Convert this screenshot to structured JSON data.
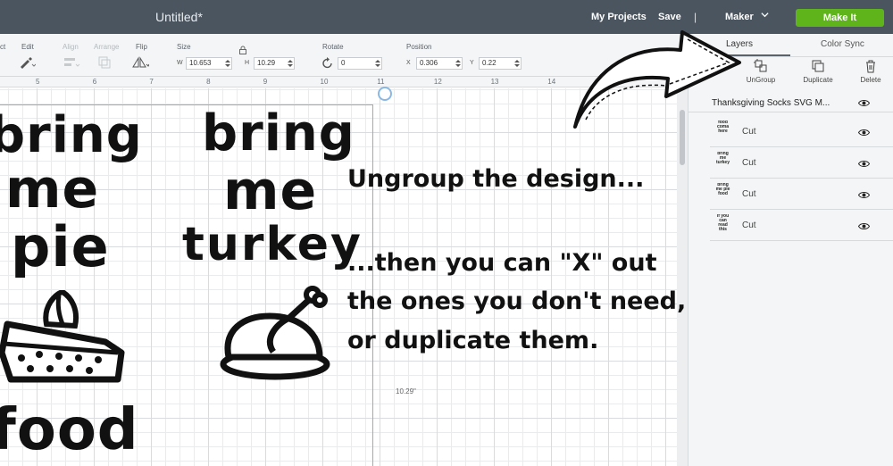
{
  "topbar": {
    "title": "Untitled*",
    "my_projects": "My Projects",
    "save": "Save",
    "separator": "|",
    "machine": "Maker",
    "make_it": "Make It",
    "make_it_color": "#5fb41c"
  },
  "toolbar": {
    "select_label": "ct",
    "edit_label": "Edit",
    "align_label": "Align",
    "arrange_label": "Arrange",
    "flip_label": "Flip",
    "size_label": "Size",
    "width_tag": "W",
    "width_value": "10.653",
    "height_tag": "H",
    "height_value": "10.29",
    "rotate_label": "Rotate",
    "rotate_value": "0",
    "position_label": "Position",
    "x_tag": "X",
    "x_value": "0.306",
    "y_tag": "Y",
    "y_value": "0.22"
  },
  "ruler": {
    "ticks": [
      "5",
      "6",
      "7",
      "8",
      "9",
      "10",
      "11",
      "12",
      "13",
      "14"
    ]
  },
  "canvas": {
    "dimension_label": "10.29\"",
    "design1": [
      "bring",
      "me",
      "pie",
      "food"
    ],
    "design2": [
      "bring",
      "me",
      "turkey"
    ]
  },
  "annotations": {
    "line1": "Ungroup the design...",
    "line2": "...then you can \"X\" out",
    "line3": "the ones you don't need,",
    "line4": "or duplicate them."
  },
  "panel": {
    "tabs": [
      "Layers",
      "Color Sync"
    ],
    "buttons": {
      "ungroup": "UnGroup",
      "duplicate": "Duplicate",
      "delete": "Delete"
    },
    "group_name": "Thanksgiving Socks SVG M...",
    "layers": [
      {
        "thumb": "food coma here",
        "label": "Cut"
      },
      {
        "thumb": "bring me turkey",
        "label": "Cut"
      },
      {
        "thumb": "bring me pie food",
        "label": "Cut"
      },
      {
        "thumb": "if you can read this",
        "label": "Cut"
      }
    ]
  }
}
